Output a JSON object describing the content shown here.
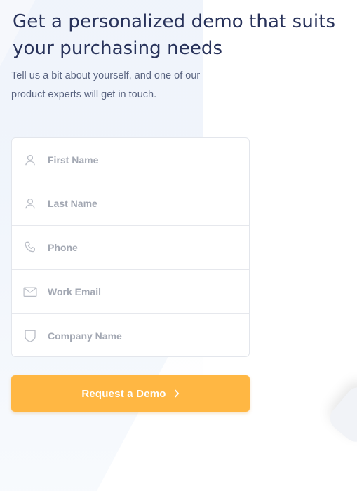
{
  "heading": "Get a personalized demo that suits your purchasing needs",
  "subtext": "Tell us a bit about yourself, and one of our product experts will get in touch.",
  "form": {
    "fields": [
      {
        "placeholder": "First Name",
        "value": "",
        "icon": "user-icon"
      },
      {
        "placeholder": "Last Name",
        "value": "",
        "icon": "user-icon"
      },
      {
        "placeholder": "Phone",
        "value": "",
        "icon": "phone-icon"
      },
      {
        "placeholder": "Work Email",
        "value": "",
        "icon": "mail-icon"
      },
      {
        "placeholder": "Company Name",
        "value": "",
        "icon": "shield-icon"
      }
    ]
  },
  "cta": {
    "label": "Request a Demo",
    "icon": "chevron-right-icon"
  },
  "colors": {
    "heading": "#28325a",
    "subtext": "#5a6480",
    "placeholder": "#a3a8b3",
    "accent": "#ffb743",
    "border": "#e3e6ec",
    "icon": "#b9bdc6"
  }
}
